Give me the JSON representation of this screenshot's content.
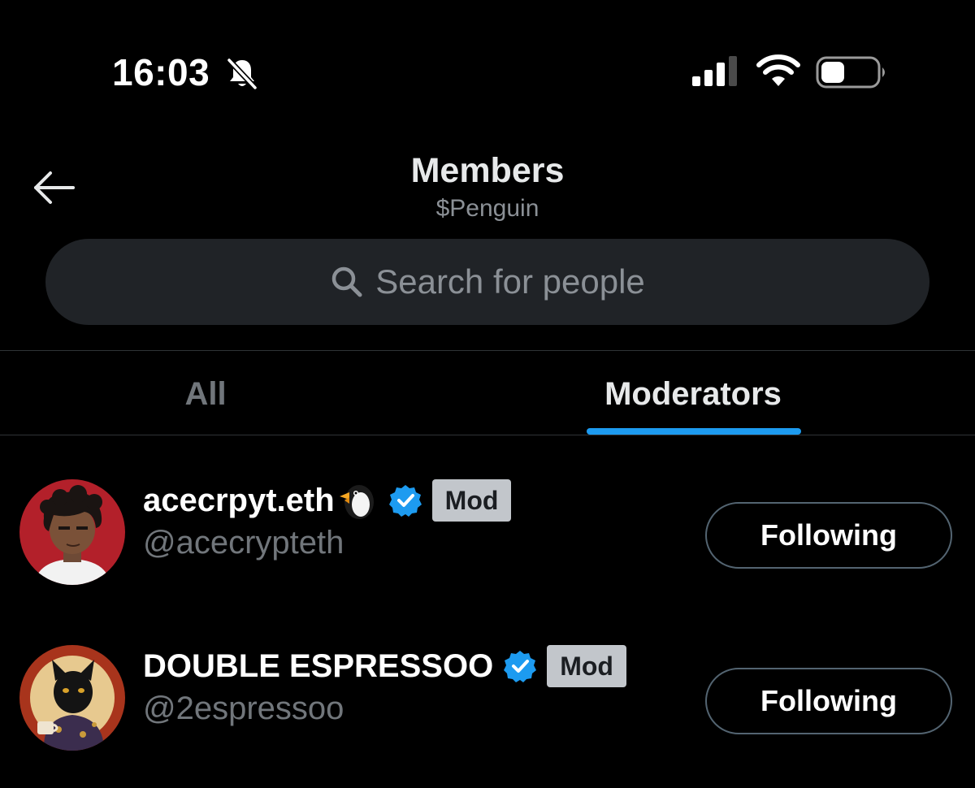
{
  "status_bar": {
    "time": "16:03",
    "icons": [
      "bell-slash-icon",
      "cellular-signal-icon",
      "wifi-icon",
      "battery-icon"
    ]
  },
  "header": {
    "title": "Members",
    "subtitle": "$Penguin",
    "back_icon": "arrow-left-icon"
  },
  "search": {
    "placeholder": "Search for people",
    "icon": "search-icon"
  },
  "tabs": [
    {
      "label": "All",
      "active": false
    },
    {
      "label": "Moderators",
      "active": true
    }
  ],
  "members": [
    {
      "name": "acecrpyt.eth",
      "name_emoji": "penguin-emoji",
      "verified": true,
      "badge": "Mod",
      "handle": "@acecrypteth",
      "button_label": "Following"
    },
    {
      "name": "DOUBLE ESPRESSOO",
      "verified": true,
      "badge": "Mod",
      "handle": "@2espressoo",
      "button_label": "Following"
    }
  ],
  "colors": {
    "background": "#000000",
    "accent": "#1d9bf0",
    "search_bg": "#202327",
    "muted_text": "#71767b",
    "badge_bg": "#c2c6cb"
  }
}
